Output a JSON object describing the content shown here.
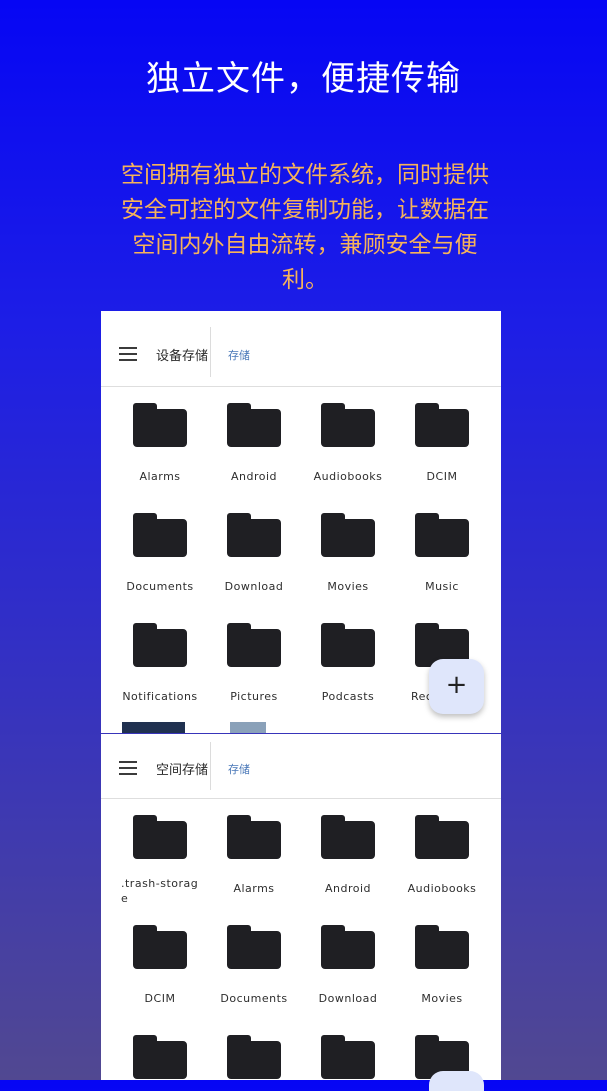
{
  "headline": "独立文件，便捷传输",
  "description": "空间拥有独立的文件系统，同时提供安全可控的文件复制功能，让数据在空间内外自由流转，兼顾安全与便利。",
  "colors": {
    "headline": "#ffffff",
    "description": "#f6b35a",
    "folder": "#1f1f23",
    "accent": "#4a78b8"
  },
  "top_panel": {
    "title": "设备存储",
    "breadcrumb": "存储",
    "folders": [
      "Alarms",
      "Android",
      "Audiobooks",
      "DCIM",
      "Documents",
      "Download",
      "Movies",
      "Music",
      "Notifications",
      "Pictures",
      "Podcasts",
      "Rec"
    ],
    "fab_icon": "plus-icon",
    "fab_symbol": "+"
  },
  "bottom_panel": {
    "title": "空间存储",
    "breadcrumb": "存储",
    "folders": [
      ".trash-storage",
      "Alarms",
      "Android",
      "Audiobooks",
      "DCIM",
      "Documents",
      "Download",
      "Movies"
    ]
  }
}
